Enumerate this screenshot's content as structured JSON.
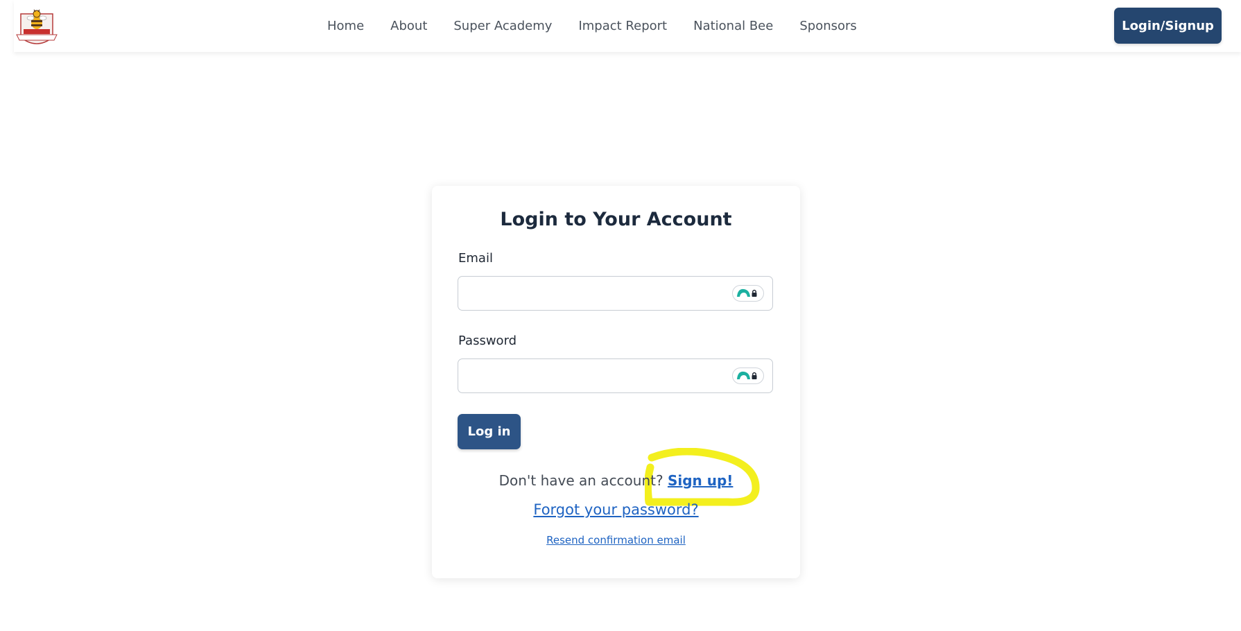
{
  "header": {
    "logo_icon": "spelling-bee-logo-icon",
    "nav": [
      {
        "label": "Home"
      },
      {
        "label": "About"
      },
      {
        "label": "Super Academy"
      },
      {
        "label": "Impact Report"
      },
      {
        "label": "National Bee"
      },
      {
        "label": "Sponsors"
      }
    ],
    "login_signup_label": "Login/Signup"
  },
  "login_form": {
    "title": "Login to Your Account",
    "email": {
      "label": "Email",
      "value": "",
      "placeholder": ""
    },
    "password": {
      "label": "Password",
      "value": "",
      "placeholder": ""
    },
    "password_manager_icon": "password-manager-lock-icon",
    "submit_label": "Log in",
    "signup_prompt": "Don't have an account?",
    "signup_link": "Sign up!",
    "forgot_link": "Forgot your password?",
    "resend_link": "Resend confirmation email"
  },
  "colors": {
    "primary_button": "#25466f",
    "login_button": "#2d5486",
    "link": "#1e63c2",
    "highlight": "#f2ee12"
  }
}
